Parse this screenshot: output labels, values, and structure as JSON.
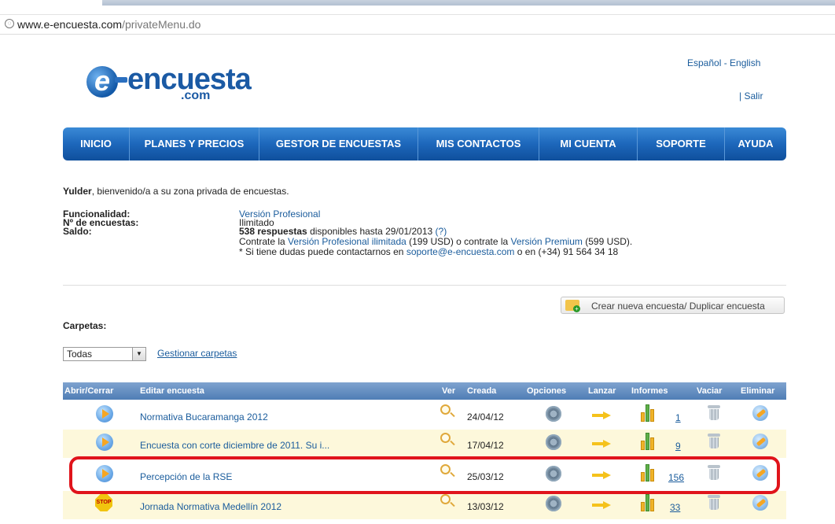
{
  "browser": {
    "url_host": "www.e-encuesta.com",
    "url_path": "/privateMenu.do"
  },
  "logo": {
    "e": "e",
    "word": "encuesta",
    "tld": ".com"
  },
  "header": {
    "languages": "Español - English",
    "logout": "| Salir"
  },
  "nav": {
    "items": [
      {
        "label": "INICIO"
      },
      {
        "label": "PLANES Y PRECIOS"
      },
      {
        "label": "GESTOR DE ENCUESTAS"
      },
      {
        "label": "MIS CONTACTOS"
      },
      {
        "label": "MI CUENTA"
      },
      {
        "label": "SOPORTE"
      },
      {
        "label": "AYUDA"
      }
    ]
  },
  "welcome": {
    "user": "Yulder",
    "text": ", bienvenido/a a su zona privada de encuestas."
  },
  "account": {
    "func_label": "Funcionalidad:",
    "func_value": "Versión Profesional",
    "count_label": "Nº de encuestas:",
    "count_value": "Ilimitado",
    "saldo_label": "Saldo:",
    "saldo_bold": "538 respuestas",
    "saldo_rest": " disponibles hasta 29/01/2013 ",
    "saldo_help": "(?)",
    "upgrade_pre": "Contrate la ",
    "upgrade_link1": "Versión Profesional ilimitada",
    "upgrade_mid": " (199 USD) o contrate la ",
    "upgrade_link2": "Versión Premium",
    "upgrade_post": " (599 USD).",
    "support_pre": "* Si tiene dudas puede contactarnos en ",
    "support_email": "soporte@e-encuesta.com",
    "support_post": " o en (+34) 91 564 34 18"
  },
  "actions": {
    "new_survey": "Crear nueva encuesta/ Duplicar encuesta"
  },
  "folders": {
    "label": "Carpetas:",
    "selected": "Todas",
    "manage": "Gestionar carpetas"
  },
  "table": {
    "headers": {
      "toggle": "Abrir/Cerrar",
      "edit": "Editar encuesta",
      "view": "Ver",
      "created": "Creada",
      "options": "Opciones",
      "launch": "Lanzar",
      "reports": "Informes",
      "empty": "Vaciar",
      "delete": "Eliminar"
    },
    "rows": [
      {
        "name": "Normativa Bucaramanga 2012",
        "created": "24/04/12",
        "reports": "1",
        "status": "play"
      },
      {
        "name": "Encuesta con corte diciembre de 2011. Su i...",
        "created": "17/04/12",
        "reports": "9",
        "status": "play"
      },
      {
        "name": "Percepción de la RSE",
        "created": "25/03/12",
        "reports": "156",
        "status": "play"
      },
      {
        "name": "Jornada Normativa Medellín 2012",
        "created": "13/03/12",
        "reports": "33",
        "status": "stop",
        "stop_label": "STOP"
      }
    ]
  },
  "colors": {
    "nav_blue": "#1d67bb",
    "link": "#1a5c9c",
    "highlight_red": "#e0141b",
    "row_alt": "#fdf8db"
  }
}
